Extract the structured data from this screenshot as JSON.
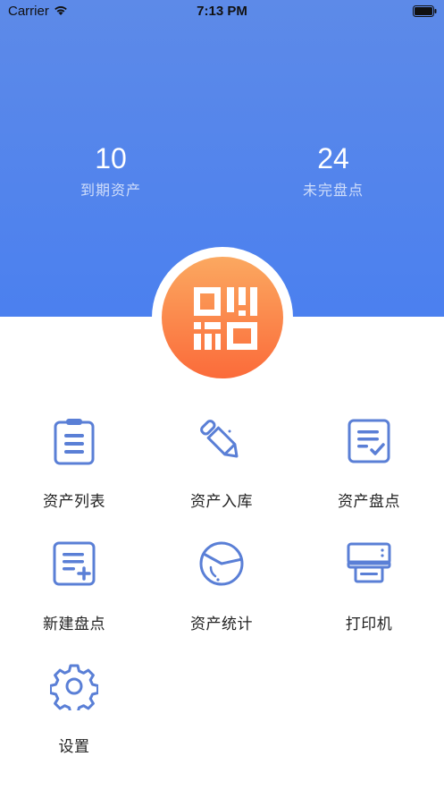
{
  "status_bar": {
    "carrier": "Carrier",
    "time": "7:13 PM"
  },
  "stats": {
    "expired": {
      "value": "10",
      "label": "到期资产"
    },
    "unfinished": {
      "value": "24",
      "label": "未完盘点"
    }
  },
  "scan_button": {
    "icon": "qr-scan-icon"
  },
  "menu": [
    {
      "label": "资产列表",
      "icon": "clipboard-list-icon"
    },
    {
      "label": "资产入库",
      "icon": "pencil-icon"
    },
    {
      "label": "资产盘点",
      "icon": "document-check-icon"
    },
    {
      "label": "新建盘点",
      "icon": "document-add-icon"
    },
    {
      "label": "资产统计",
      "icon": "pie-chart-icon"
    },
    {
      "label": "打印机",
      "icon": "printer-icon"
    },
    {
      "label": "设置",
      "icon": "gear-icon"
    }
  ],
  "colors": {
    "header": "#4b80ef",
    "icon": "#5a7fd6",
    "scan_orange": "#fb7a42"
  }
}
